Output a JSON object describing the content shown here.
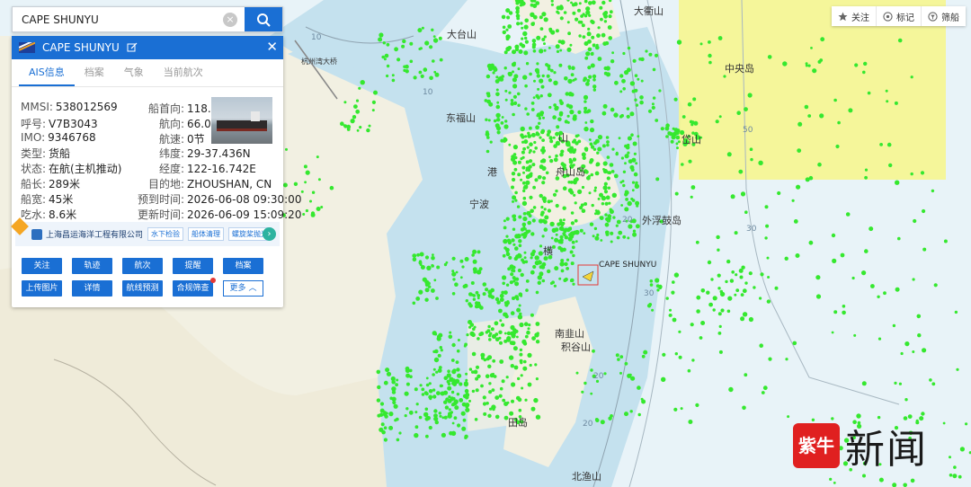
{
  "search": {
    "value": "CAPE SHUNYU",
    "placeholder": ""
  },
  "panel": {
    "title": "CAPE SHUNYU",
    "tabs": [
      "AIS信息",
      "档案",
      "气象",
      "当前航次"
    ],
    "left_fields": [
      {
        "k": "MMSI:",
        "v": "538012569"
      },
      {
        "k": "呼号:",
        "v": "V7B3043"
      },
      {
        "k": "IMO:",
        "v": "9346768"
      },
      {
        "k": "类型:",
        "v": "货船"
      },
      {
        "k": "状态:",
        "v": "在航(主机推动)"
      },
      {
        "k": "船长:",
        "v": "289米"
      },
      {
        "k": "船宽:",
        "v": "45米"
      },
      {
        "k": "吃水:",
        "v": "8.6米"
      }
    ],
    "right_fields": [
      {
        "k": "船首向:",
        "v": "118.0度"
      },
      {
        "k": "航向:",
        "v": "66.0度"
      },
      {
        "k": "航速:",
        "v": "0节"
      },
      {
        "k": "纬度:",
        "v": "29-37.436N"
      },
      {
        "k": "经度:",
        "v": "122-16.742E"
      },
      {
        "k": "目的地:",
        "v": "ZHOUSHAN, CN"
      },
      {
        "k": "预到时间:",
        "v": "2026-06-08 09:30:00"
      },
      {
        "k": "更新时间:",
        "v": "2026-06-09 15:09:20"
      }
    ],
    "company": {
      "name": "上海昌运海洋工程有限公司",
      "tags": [
        "水下检验",
        "船体清理",
        "螺旋桨抛光"
      ]
    },
    "buttons_row1": [
      "关注",
      "轨迹",
      "航次",
      "提醒",
      "档案"
    ],
    "buttons_row2": [
      "上传图片",
      "详情",
      "航线预测",
      "合规筛查"
    ],
    "more_label": "更多"
  },
  "toolbar": {
    "items": [
      "关注",
      "标记",
      "筛船"
    ]
  },
  "map": {
    "ship_label": "CAPE SHUNYU",
    "places": [
      {
        "name": "大衢山"
      },
      {
        "name": "中央岛"
      },
      {
        "name": "大台山"
      },
      {
        "name": "杭州湾大桥"
      },
      {
        "name": "东福山"
      },
      {
        "name": "山"
      },
      {
        "name": "岱山"
      },
      {
        "name": "舟山岛"
      },
      {
        "name": "宁波"
      },
      {
        "name": "横"
      },
      {
        "name": "外浮鼓岛"
      },
      {
        "name": "南韭山"
      },
      {
        "name": "积谷山"
      },
      {
        "name": "田岛"
      },
      {
        "name": "北渔山"
      },
      {
        "name": "港"
      }
    ],
    "depths": [
      "10",
      "10",
      "20",
      "30",
      "30",
      "50",
      "20",
      "20"
    ]
  },
  "watermark": {
    "seal": "紫牛",
    "text": "新闻"
  },
  "colors": {
    "accent": "#1a6fd4",
    "land": "#f3f1e4",
    "sea": "#c5e2ef",
    "deep_sea": "#e7f2f7",
    "ship_dot": "#35e82f",
    "zone": "#f5f58c"
  }
}
